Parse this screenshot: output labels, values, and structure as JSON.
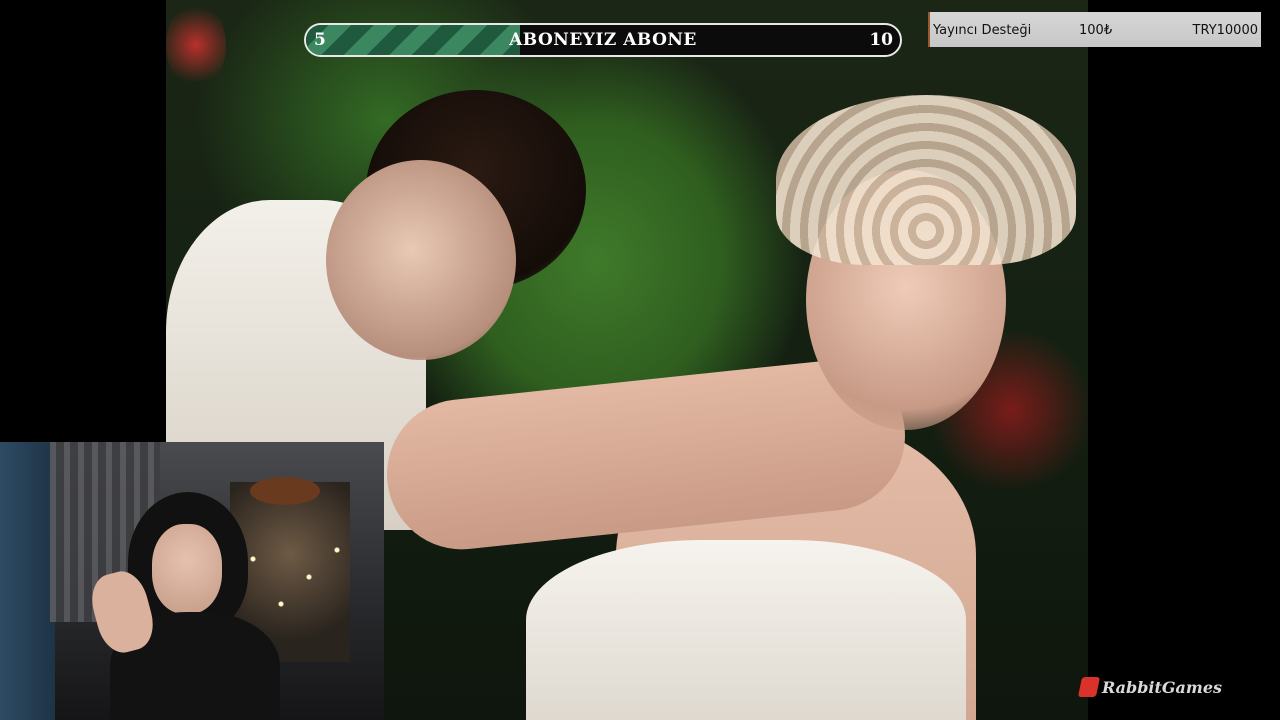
{
  "goal": {
    "start": "5",
    "end": "10",
    "title": "ABONEYIZ ABONE",
    "progress_fraction": 0.36
  },
  "donation": {
    "label": "Yayıncı Desteği",
    "amount": "100₺",
    "target": "TRY10000"
  },
  "watermark": {
    "logo_icon": "brand-logo-icon",
    "text": "RabbitGames"
  },
  "colors": {
    "goal_fill_dark": "#1f5a3e",
    "goal_fill_light": "#3b8760",
    "goal_border": "#e8e8e8",
    "donation_bg": "#d0d0d0"
  }
}
